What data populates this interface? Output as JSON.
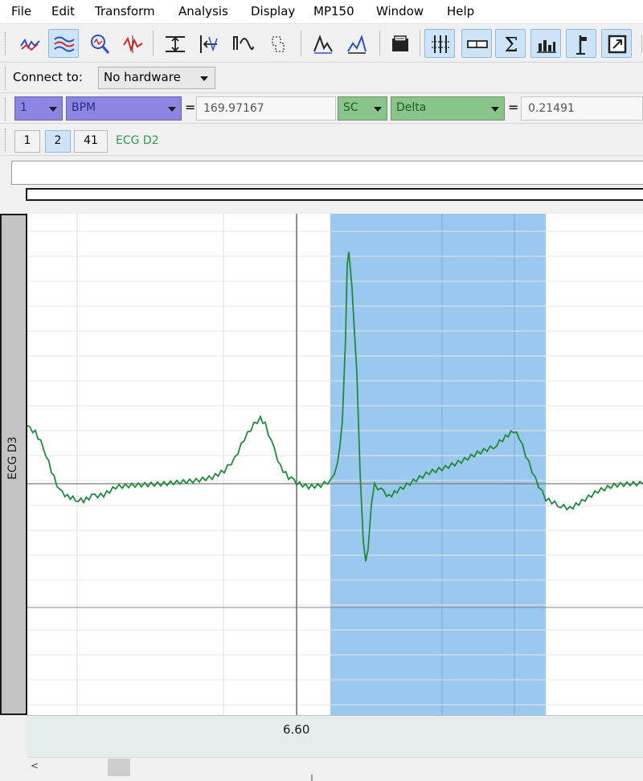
{
  "menu": [
    "File",
    "Edit",
    "Transform",
    "Analysis",
    "Display",
    "MP150",
    "Window",
    "Help"
  ],
  "toolbar": {
    "tools": [
      {
        "name": "cursor-tool-icon",
        "active": false
      },
      {
        "name": "overlap-segments-icon",
        "active": true
      },
      {
        "name": "zoom-tool-icon",
        "active": false
      },
      {
        "name": "waveform-edit-icon",
        "active": false
      },
      {
        "name": "autoscale-amplitude-icon",
        "active": false
      },
      {
        "name": "autoscale-horizontal-icon",
        "active": false
      },
      {
        "name": "overlap-waveforms-icon",
        "active": false
      },
      {
        "name": "adjust-baseline-icon",
        "active": false
      },
      {
        "name": "find-peak-icon",
        "active": false
      },
      {
        "name": "find-next-peak-icon",
        "active": false
      },
      {
        "name": "open-folder-icon",
        "active": false
      },
      {
        "name": "grid-toggle-icon",
        "active": true
      },
      {
        "name": "marker-toggle-icon",
        "active": true
      },
      {
        "name": "sigma-icon",
        "active": true
      },
      {
        "name": "histogram-icon",
        "active": true
      },
      {
        "name": "flag-marker-icon",
        "active": true
      },
      {
        "name": "show-journal-icon",
        "active": true
      }
    ]
  },
  "connection": {
    "label": "Connect to:",
    "hardware": "No hardware"
  },
  "measurement": {
    "m1_channel": "1",
    "m1_type": "BPM",
    "m1_value": "169.97167",
    "m2_channel": "SC",
    "m2_type": "Delta",
    "m2_value": "0.21491",
    "equals": "="
  },
  "channels": {
    "buttons": [
      {
        "label": "1",
        "active": false
      },
      {
        "label": "2",
        "active": true
      },
      {
        "label": "41",
        "active": false
      }
    ],
    "name": "ECG D2"
  },
  "graph": {
    "channel_label": "ECG D3"
  },
  "axis": {
    "time_label": "6.60"
  },
  "scroll": {
    "left_arrow": "<"
  },
  "colors": {
    "trace": "#1f8a3c",
    "selection": "#9bc8ee",
    "menu_accent": "#8c86e2",
    "channel_green": "#89c48a"
  }
}
